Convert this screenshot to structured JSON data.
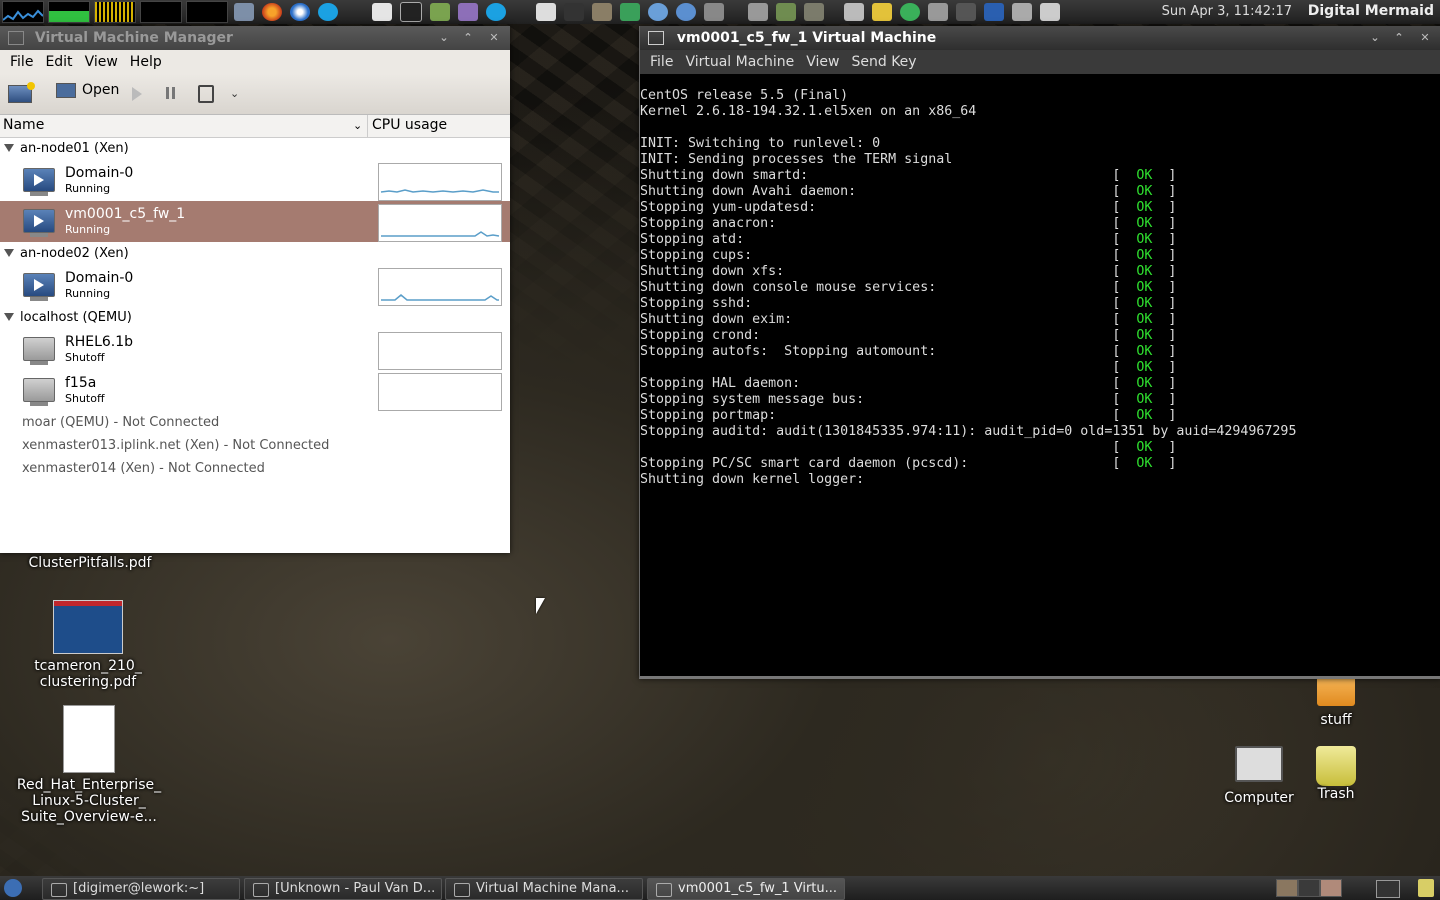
{
  "top_panel": {
    "clock": "Sun Apr  3, 11:42:17",
    "username": "Digital Mermaid"
  },
  "vmm": {
    "title": "Virtual Machine Manager",
    "menu": [
      "File",
      "Edit",
      "View",
      "Help"
    ],
    "toolbar": {
      "open_label": "Open"
    },
    "columns": {
      "name": "Name",
      "cpu": "CPU usage"
    },
    "connections": [
      {
        "label": "an-node01 (Xen)",
        "vms": [
          {
            "name": "Domain-0",
            "status": "Running",
            "running": true
          },
          {
            "name": "vm0001_c5_fw_1",
            "status": "Running",
            "running": true,
            "selected": true
          }
        ]
      },
      {
        "label": "an-node02 (Xen)",
        "vms": [
          {
            "name": "Domain-0",
            "status": "Running",
            "running": true
          }
        ]
      },
      {
        "label": "localhost (QEMU)",
        "vms": [
          {
            "name": "RHEL6.1b",
            "status": "Shutoff",
            "running": false
          },
          {
            "name": "f15a",
            "status": "Shutoff",
            "running": false
          }
        ]
      }
    ],
    "not_connected": [
      "moar (QEMU) - Not Connected",
      "xenmaster013.iplink.net (Xen) - Not Connected",
      "xenmaster014 (Xen) - Not Connected"
    ]
  },
  "console": {
    "title": "vm0001_c5_fw_1 Virtual Machine",
    "menu": [
      "File",
      "Virtual Machine",
      "View",
      "Send Key"
    ],
    "lines": [
      {
        "text": "CentOS release 5.5 (Final)",
        "ok": false
      },
      {
        "text": "Kernel 2.6.18-194.32.1.el5xen on an x86_64",
        "ok": false
      },
      {
        "text": "",
        "ok": false
      },
      {
        "text": "INIT: Switching to runlevel: 0",
        "ok": false
      },
      {
        "text": "INIT: Sending processes the TERM signal",
        "ok": false
      },
      {
        "text": "Shutting down smartd:",
        "ok": true
      },
      {
        "text": "Shutting down Avahi daemon:",
        "ok": true
      },
      {
        "text": "Stopping yum-updatesd:",
        "ok": true
      },
      {
        "text": "Stopping anacron:",
        "ok": true
      },
      {
        "text": "Stopping atd:",
        "ok": true
      },
      {
        "text": "Stopping cups:",
        "ok": true
      },
      {
        "text": "Shutting down xfs:",
        "ok": true
      },
      {
        "text": "Shutting down console mouse services:",
        "ok": true
      },
      {
        "text": "Stopping sshd:",
        "ok": true
      },
      {
        "text": "Shutting down exim:",
        "ok": true
      },
      {
        "text": "Stopping crond:",
        "ok": true
      },
      {
        "text": "Stopping autofs:  Stopping automount:",
        "ok": true
      },
      {
        "text": "",
        "ok": true
      },
      {
        "text": "Stopping HAL daemon:",
        "ok": true
      },
      {
        "text": "Stopping system message bus:",
        "ok": true
      },
      {
        "text": "Stopping portmap:",
        "ok": true
      },
      {
        "text": "Stopping auditd: audit(1301845335.974:11): audit_pid=0 old=1351 by auid=4294967295",
        "ok": false
      },
      {
        "text": "",
        "ok": true
      },
      {
        "text": "Stopping PC/SC smart card daemon (pcscd):",
        "ok": true
      },
      {
        "text": "Shutting down kernel logger:",
        "ok": false
      }
    ],
    "ok_text": "OK"
  },
  "desktop": {
    "icons_left": [
      "ClusterPitfalls.pdf",
      "tcameron_210_\nclustering.pdf",
      "Red_Hat_Enterprise_\nLinux-5-Cluster_\nSuite_Overview-e..."
    ],
    "icons_right": [
      "stuff",
      "Computer",
      "Trash"
    ]
  },
  "taskbar": [
    {
      "label": "[digimer@lework:~]",
      "active": false
    },
    {
      "label": "[Unknown - Paul Van D...",
      "active": false
    },
    {
      "label": "Virtual Machine Mana...",
      "active": false
    },
    {
      "label": "vm0001_c5_fw_1 Virtu...",
      "active": true
    }
  ],
  "colors": {
    "selected_row": "#a57b70",
    "ok_green": "#2fe02f",
    "graph_line": "#5a9ec9"
  }
}
